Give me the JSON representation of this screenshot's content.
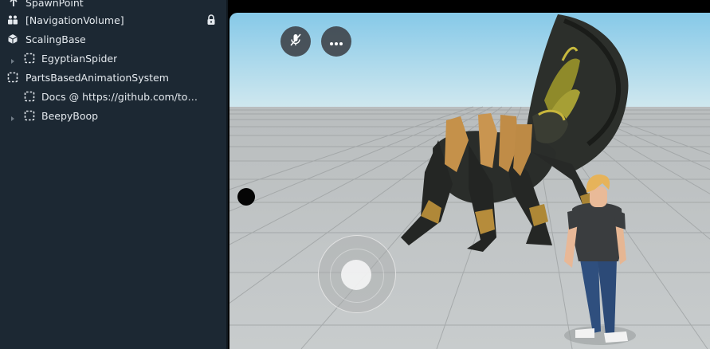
{
  "hierarchy": {
    "items": [
      {
        "label": "SpawnPoint",
        "icon": "spawn-point-icon",
        "expandable": false,
        "depth": 0
      },
      {
        "label": "[NavigationVolume]",
        "icon": "navigation-volume-icon",
        "expandable": false,
        "depth": 0,
        "locked": true
      },
      {
        "label": "ScalingBase",
        "icon": "cube-icon",
        "expandable": false,
        "depth": 0
      },
      {
        "label": "EgyptianSpider",
        "icon": "empty-object-icon",
        "expandable": true,
        "depth": 1
      },
      {
        "label": "PartsBasedAnimationSystem",
        "icon": "empty-object-icon",
        "expandable": false,
        "depth": 0
      },
      {
        "label": "Docs @ https://github.com/tod...",
        "icon": "empty-object-icon",
        "expandable": false,
        "depth": 1
      },
      {
        "label": "BeepyBoop",
        "icon": "empty-object-icon",
        "expandable": true,
        "depth": 1
      }
    ]
  },
  "viewport": {
    "controls": {
      "mute_icon": "mic-muted-icon",
      "more_icon": "more-horizontal-icon"
    },
    "joystick_icon": "virtual-joystick",
    "colors": {
      "sky_top": "#86c9e8",
      "sky_bottom": "#cfe7ef",
      "ground": "#c3c7c8",
      "grid": "#9fa3a4"
    }
  }
}
